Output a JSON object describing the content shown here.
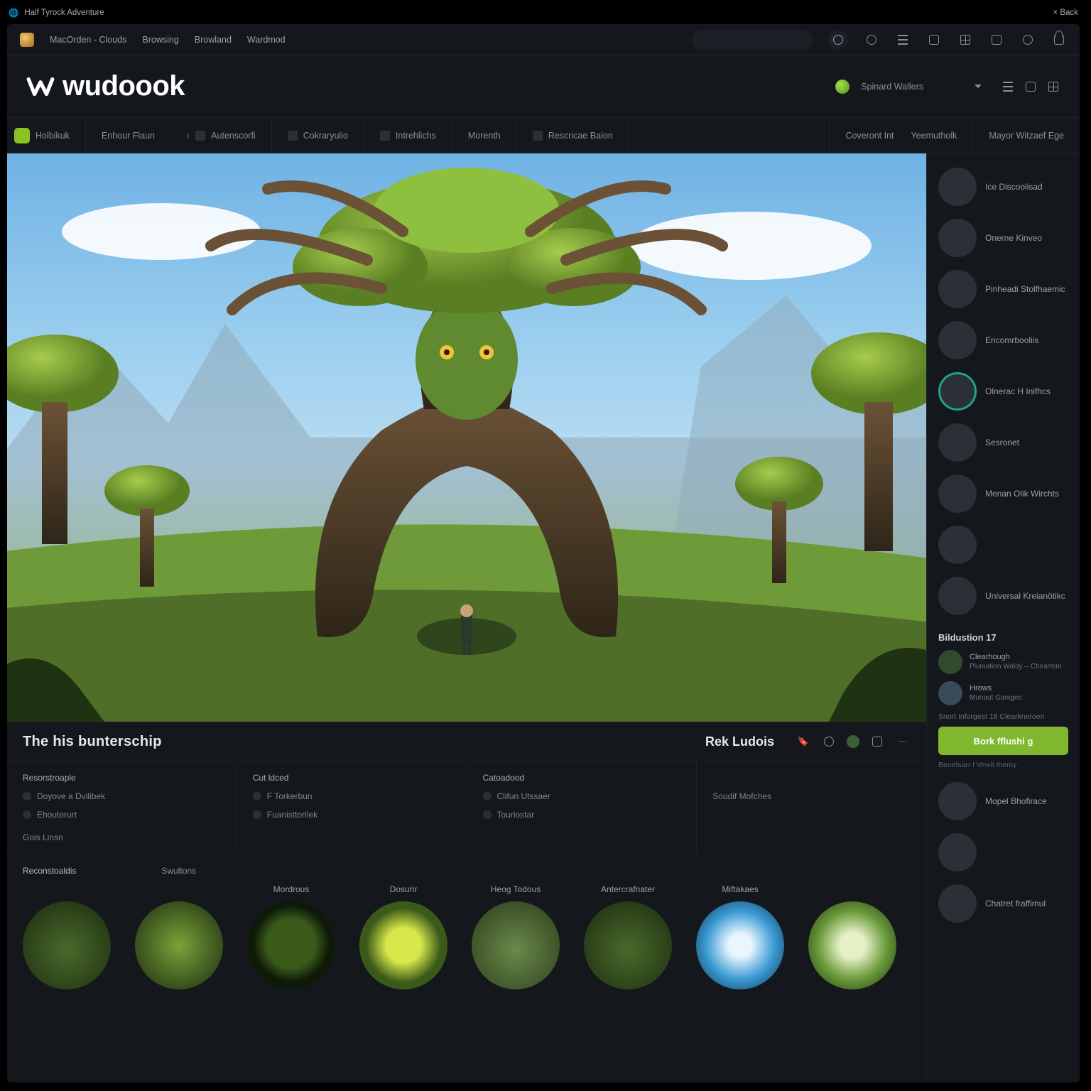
{
  "addrbar": {
    "left": "Half Tyrock Adventure",
    "right": "× Back"
  },
  "topnav": {
    "items": [
      "MacOrden - Clouds",
      "Browsing",
      "Browland",
      "Wardmod"
    ],
    "search_placeholder": ""
  },
  "brand": {
    "name": "wudoook",
    "user": "Spinard Wallers",
    "status": "Online"
  },
  "tabs": {
    "items": [
      {
        "label": "Holbikuk"
      },
      {
        "label": "Enhour Flaun"
      },
      {
        "label": "Autenscorfi"
      },
      {
        "label": "Cokraryulio"
      },
      {
        "label": "Intrehlichs"
      },
      {
        "label": "Morenth"
      },
      {
        "label": "Rescricae Baion"
      }
    ],
    "right": [
      "Coveront Int",
      "Yeemutholk"
    ],
    "side_head": "Mayor Witzaef Ege"
  },
  "section": {
    "title": "The his bunterschip",
    "subtitle": "Rek Ludois"
  },
  "info": {
    "col0": {
      "head": "Resorstroaple",
      "rows": [
        "Doyove a Dvilibek",
        "Ehouterurt"
      ],
      "foot": "Gois Linsn"
    },
    "col1": {
      "head": "Cut ldced",
      "rows": [
        "F Torkerbun",
        "Fuanisttorilek"
      ]
    },
    "col2": {
      "head": "Catoadood",
      "rows": [
        "Clifun Utssaer",
        "Touriostar"
      ]
    },
    "col3": {
      "head": "",
      "rows": [
        "Soudif Mofches"
      ]
    }
  },
  "gallery": {
    "heads": [
      "Reconstoaldis",
      "Swultons"
    ],
    "items": [
      "",
      "",
      "Mordrous",
      "Dosurir",
      "Heog Todous",
      "Antercrafnater",
      "Miftakaes",
      ""
    ]
  },
  "sidebar": {
    "items": [
      "Ice Discoolisad",
      "Onerne Kinveo",
      "Pinheadi Stolfhaemic",
      "Encomrbooliis",
      "Olnerac H Inifhcs",
      "Sesronet",
      "Menan Olik Wirchts",
      "",
      "Universal Kreianötikc",
      "",
      "Mopel Bhofirace"
    ],
    "box": {
      "head": "Bildustion 17",
      "rows": [
        {
          "t": "Clearhough",
          "s": "Plumation Waldy – Cheartem"
        },
        {
          "t": "Hrows",
          "s": "Munaut Ganiges"
        }
      ],
      "hint": "Snort Inforgest 18 Clearkneroen",
      "cta": "Bork fflushi g",
      "foot": "Benetsarr l Vewit themy"
    },
    "last": "Chatret fraffimul"
  }
}
